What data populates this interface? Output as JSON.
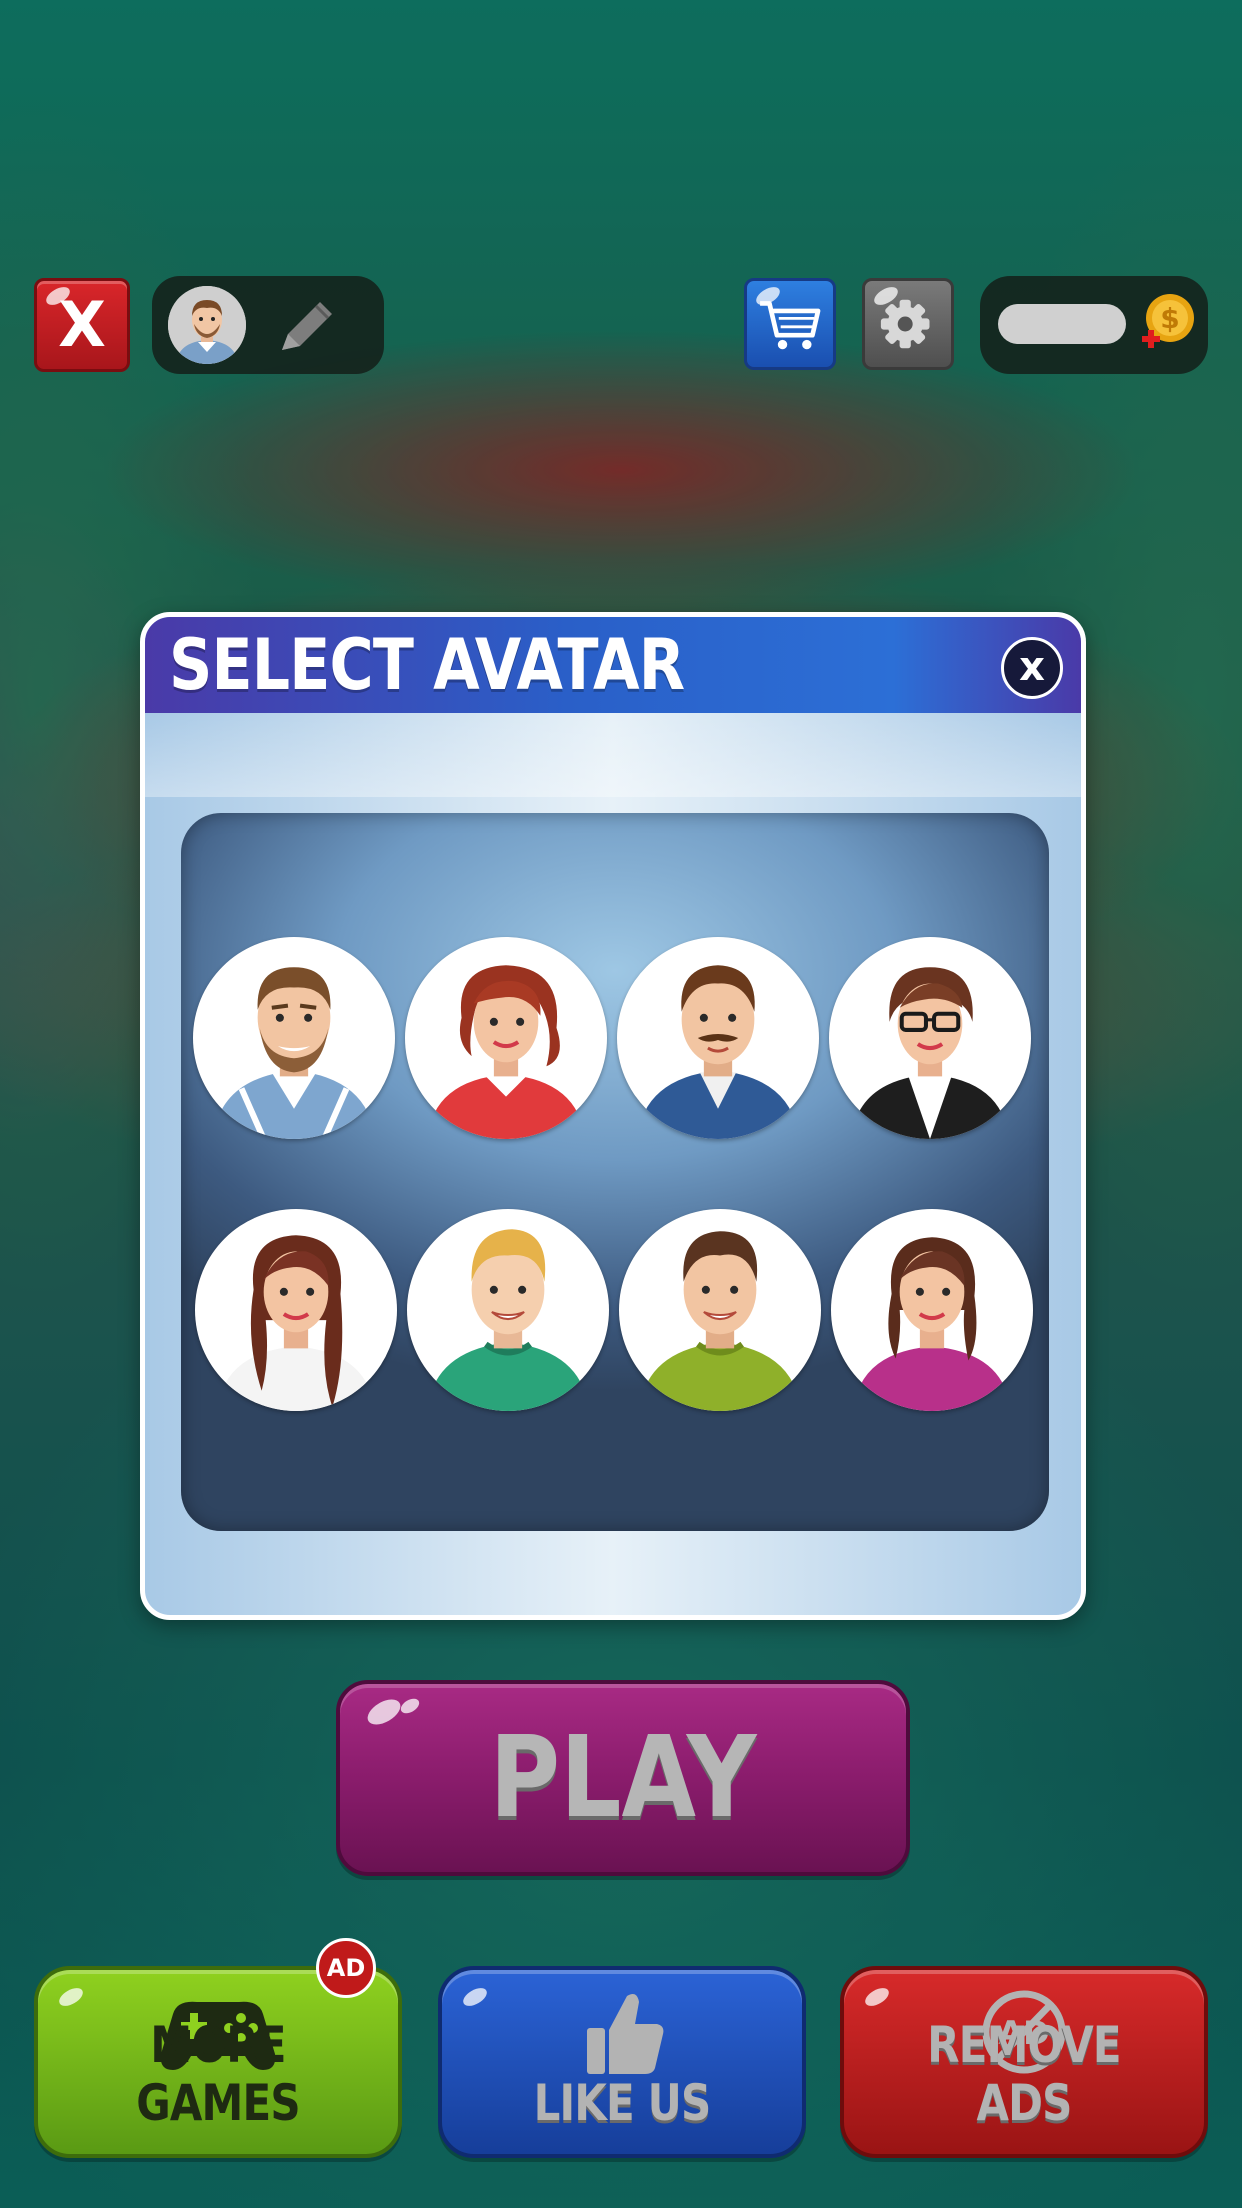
{
  "top_bar": {
    "exit_label": "X",
    "profile_edit_icon": "pencil-icon",
    "shop_icon": "cart-icon",
    "settings_icon": "gear-icon",
    "coin_icon": "coin-plus-icon"
  },
  "dialog": {
    "title": "SELECT AVATAR",
    "close_label": "x",
    "avatars": [
      {
        "name": "bearded-man-plaid"
      },
      {
        "name": "red-hair-woman"
      },
      {
        "name": "mustache-man-denim"
      },
      {
        "name": "glasses-woman-suit"
      },
      {
        "name": "long-hair-woman-white"
      },
      {
        "name": "blond-man-green"
      },
      {
        "name": "dark-hair-man-lime"
      },
      {
        "name": "brunette-woman-magenta"
      }
    ]
  },
  "play": {
    "label": "PLAY"
  },
  "bottom": {
    "more_games": {
      "label": "MORE GAMES",
      "badge": "AD",
      "icon": "gamepad-icon"
    },
    "like_us": {
      "label": "LIKE US",
      "icon": "thumbs-up-icon"
    },
    "remove_ads": {
      "label": "REMOVE ADS",
      "icon": "no-ad-icon",
      "icon_text": "AD"
    }
  },
  "colors": {
    "play": "#8a1c6c",
    "more_games": "#6fb31a",
    "like_us": "#1e4fb8",
    "remove_ads": "#b81d1d",
    "dialog_header": "#2a5fc8"
  }
}
